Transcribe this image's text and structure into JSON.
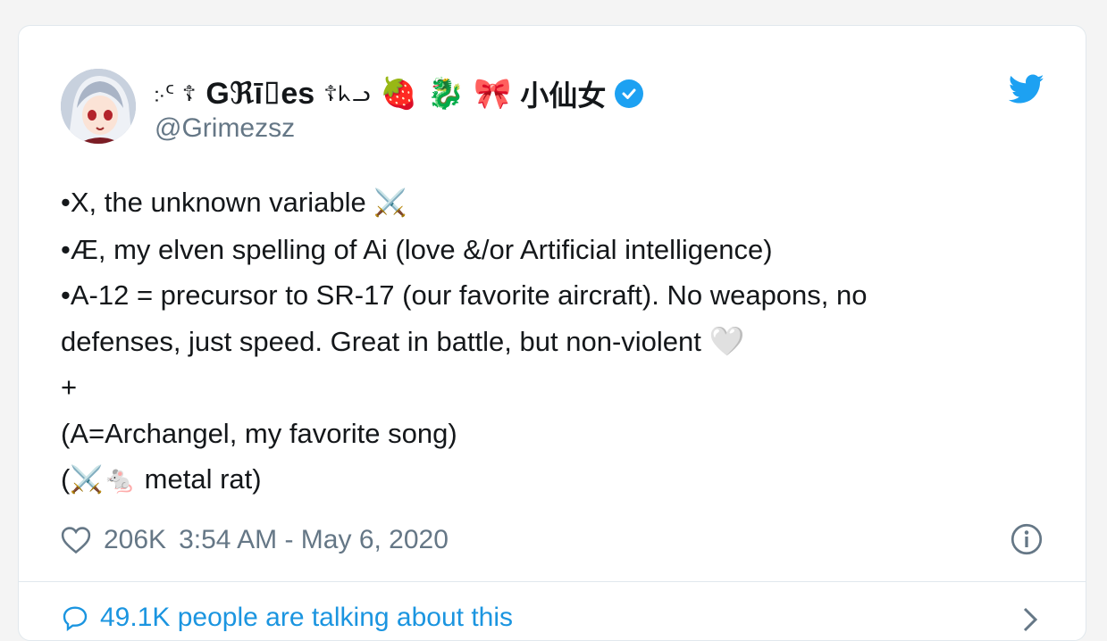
{
  "tweet": {
    "author": {
      "name_prefix": "჻ᑦ ☦",
      "name_core": "Gℜī⌷es",
      "name_suffix": "☦ᖾᓗ",
      "emojis": [
        "🍓",
        "🐉",
        "🎀"
      ],
      "name_cn": "小仙女",
      "handle": "@Grimezsz",
      "verified": true
    },
    "lines": [
      {
        "text": "•X, the unknown variable ",
        "emoji": "⚔️"
      },
      {
        "text": "•Æ, my elven spelling of Ai (love &/or Artificial intelligence)"
      },
      {
        "text": "•A-12 = precursor to SR-17 (our favorite aircraft).  No weapons, no"
      },
      {
        "text": "defenses, just speed.  Great in battle, but non-violent ",
        "emoji": "🤍"
      },
      {
        "text": "+"
      },
      {
        "text": "(A=Archangel, my favorite song)"
      },
      {
        "text_prefix": "(",
        "emoji_a": "⚔️",
        "emoji_b": "🐁",
        "text": " metal rat)"
      }
    ],
    "likes": "206K",
    "timestamp": "3:54 AM - May 6, 2020",
    "footer": "49.1K people are talking about this"
  },
  "colors": {
    "accent": "#1da1f2",
    "link": "#1b95e0",
    "muted": "#657786"
  }
}
